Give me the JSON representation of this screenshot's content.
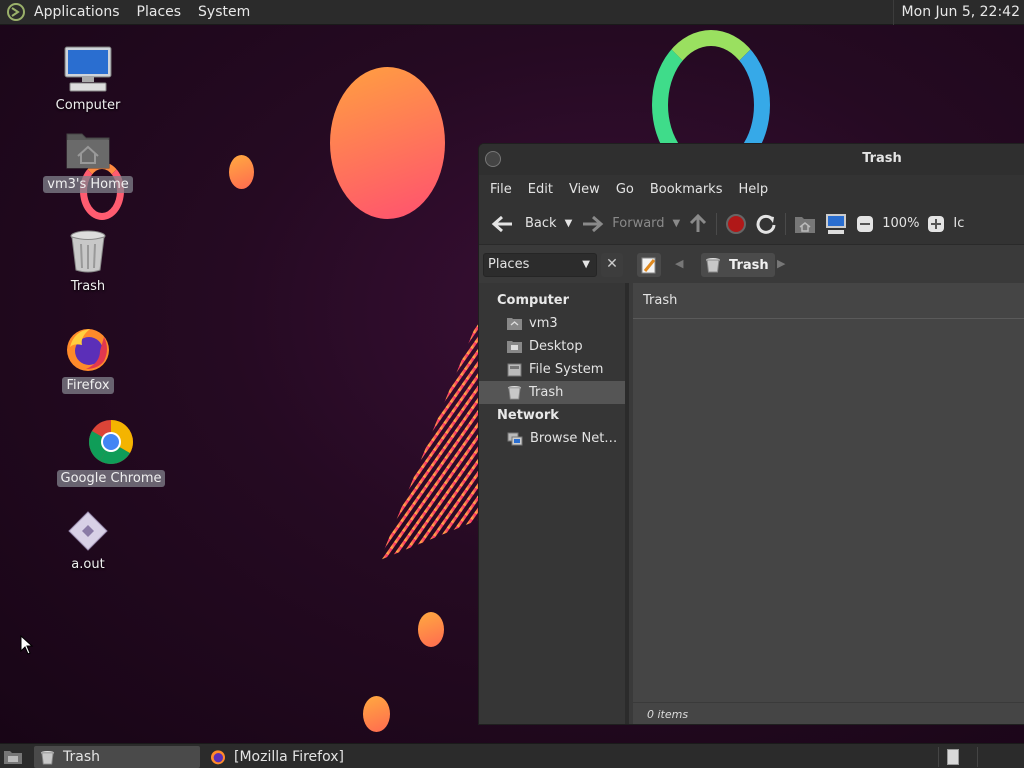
{
  "top_panel": {
    "menus": [
      "Applications",
      "Places",
      "System"
    ],
    "clock": "Mon Jun  5, 22:42"
  },
  "desktop": {
    "icons": [
      {
        "label": "Computer",
        "icon": "computer-icon"
      },
      {
        "label": "vm3's Home",
        "icon": "home-folder-icon"
      },
      {
        "label": "Trash",
        "icon": "trash-icon"
      },
      {
        "label": "Firefox",
        "icon": "firefox-icon"
      },
      {
        "label": "Google Chrome",
        "icon": "chrome-icon"
      },
      {
        "label": "a.out",
        "icon": "executable-icon"
      }
    ]
  },
  "window": {
    "title": "Trash",
    "menu": [
      "File",
      "Edit",
      "View",
      "Go",
      "Bookmarks",
      "Help"
    ],
    "toolbar": {
      "back": "Back",
      "forward": "Forward",
      "zoom": "100%",
      "view_mode": "Ic"
    },
    "places_combo": "Places",
    "breadcrumb": "Trash",
    "sidebar": {
      "computer_header": "Computer",
      "computer_items": [
        "vm3",
        "Desktop",
        "File System",
        "Trash"
      ],
      "network_header": "Network",
      "network_items": [
        "Browse Net…"
      ]
    },
    "content_header": "Trash",
    "status": "0 items"
  },
  "taskbar": {
    "tasks": [
      "Trash",
      "[Mozilla Firefox]"
    ]
  },
  "colors": {
    "panel": "#2b2b2b",
    "window_bg": "#3a3a3a",
    "content_bg": "#454545"
  }
}
